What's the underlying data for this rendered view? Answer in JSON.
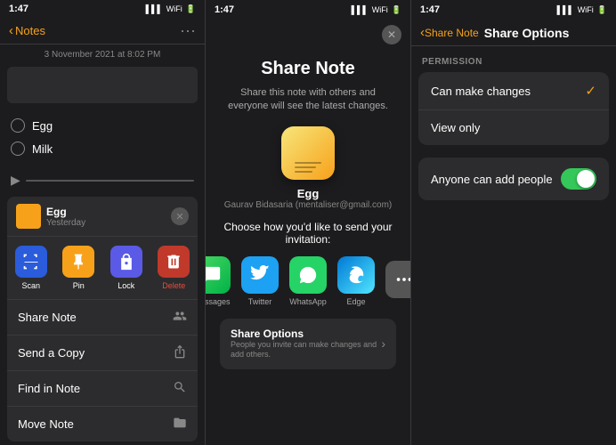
{
  "panel1": {
    "status_time": "1:47",
    "nav_back_label": "Notes",
    "note_date": "3 November 2021 at 8:02 PM",
    "items": [
      "Egg",
      "Milk"
    ],
    "context": {
      "title": "Egg",
      "subtitle": "Yesterday"
    },
    "actions": [
      {
        "id": "scan",
        "label": "Scan",
        "class": "scan"
      },
      {
        "id": "pin",
        "label": "Pin",
        "class": "pin"
      },
      {
        "id": "lock",
        "label": "Lock",
        "class": "lock"
      },
      {
        "id": "delete",
        "label": "Delete",
        "class": "delete"
      }
    ],
    "menu_items": [
      {
        "text": "Share Note",
        "icon": "👤"
      },
      {
        "text": "Send a Copy",
        "icon": "⬆️"
      },
      {
        "text": "Find in Note",
        "icon": "🔍"
      },
      {
        "text": "Move Note",
        "icon": "📁"
      }
    ]
  },
  "panel2": {
    "status_time": "1:47",
    "title": "Share Note",
    "subtitle": "Share this note with others and everyone will see the latest changes.",
    "note_name": "Egg",
    "note_email": "Gaurav Bidasaria (mentaliser@gmail.com)",
    "choose_text": "Choose how you'd like to send your invitation:",
    "apps": [
      {
        "id": "messages",
        "label": "Messages"
      },
      {
        "id": "twitter",
        "label": "Twitter"
      },
      {
        "id": "whatsapp",
        "label": "WhatsApp"
      },
      {
        "id": "edge",
        "label": "Edge"
      },
      {
        "id": "more",
        "label": ""
      }
    ],
    "share_options_title": "Share Options",
    "share_options_sub": "People you invite can make changes and add others."
  },
  "panel3": {
    "status_time": "1:47",
    "back_label": "Share Note",
    "nav_title": "Share Options",
    "section_label": "PERMISSION",
    "options": [
      {
        "text": "Can make changes",
        "checked": true
      },
      {
        "text": "View only",
        "checked": false
      }
    ],
    "toggle_label": "Anyone can add people",
    "toggle_on": true
  }
}
